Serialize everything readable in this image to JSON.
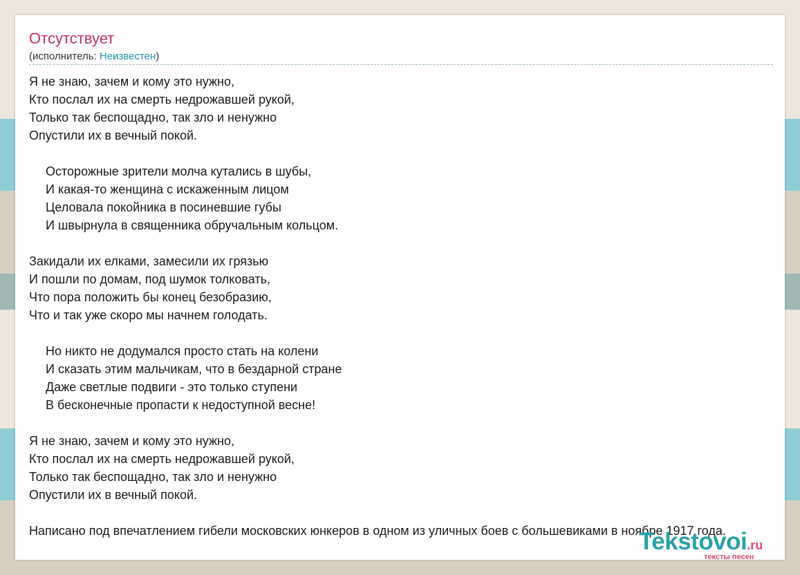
{
  "song": {
    "title": "Отсутствует",
    "artist_prefix": "(исполнитель: ",
    "artist_name": "Неизвестен",
    "artist_suffix": ")"
  },
  "stanzas": [
    {
      "indent": false,
      "lines": [
        "Я не знаю, зачем и кому это нужно,",
        "Кто послал их на смерть недрожавшей рукой,",
        "Только так беспощадно, так зло и ненужно",
        "Опустили их в вечный покой."
      ]
    },
    {
      "indent": true,
      "lines": [
        "Осторожные зрители молча кутались в шубы,",
        "И какая-то женщина с искаженным лицом",
        "Целовала покойника в посиневшие губы",
        "И швырнула в священника обручальным кольцом."
      ]
    },
    {
      "indent": false,
      "lines": [
        "Закидали их елками, замесили их грязью",
        "И пошли по домам, под шумок толковать,",
        "Что пора положить бы конец безобразию,",
        "Что и так уже скоро мы начнем голодать."
      ]
    },
    {
      "indent": true,
      "lines": [
        "Но никто не додумался просто стать на колени",
        "И сказать этим мальчикам, что в бездарной стране",
        "Даже светлые подвиги - это только ступени",
        "В бесконечные пропасти к недоступной весне!"
      ]
    },
    {
      "indent": false,
      "lines": [
        "Я не знаю, зачем и кому это нужно,",
        "Кто послал их на смерть недрожавшей рукой,",
        "Только так беспощадно, так зло и ненужно",
        "Опустили их в вечный покой."
      ]
    }
  ],
  "note": "Написано под впечатлением гибели московских юнкеров в одном из уличных боев с большевиками в ноябре 1917 года.",
  "logo": {
    "main": "Tekstovoi",
    "tld": ".ru",
    "tagline": "тексты песен"
  },
  "colors": {
    "title": "#c2315d",
    "artist_link": "#1f8f9f",
    "logo_main": "#2aa1a8",
    "logo_accent": "#d64c71"
  }
}
